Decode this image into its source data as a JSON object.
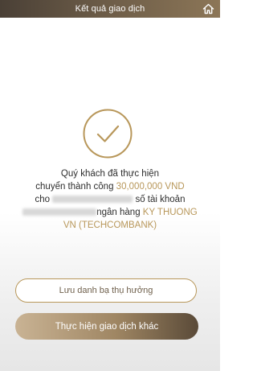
{
  "header": {
    "title": "Kết quả giao dịch",
    "home_icon": "home-icon"
  },
  "result": {
    "status_icon": "checkmark-icon",
    "accent_color": "#b8975a",
    "line1": "Quý khách đã thực hiện",
    "line2_prefix": "chuyển thành công ",
    "amount": "30,000,000 VND",
    "line3_prefix": "cho ",
    "line3_suffix": " số tài khoản",
    "line4_suffix": "ngân hàng ",
    "bank_part1": "KY THUONG",
    "bank_part2": "VN (TECHCOMBANK)"
  },
  "actions": {
    "save_beneficiary_label": "Lưu danh bạ thụ hưởng",
    "new_transaction_label": "Thực hiện giao dịch khác"
  }
}
